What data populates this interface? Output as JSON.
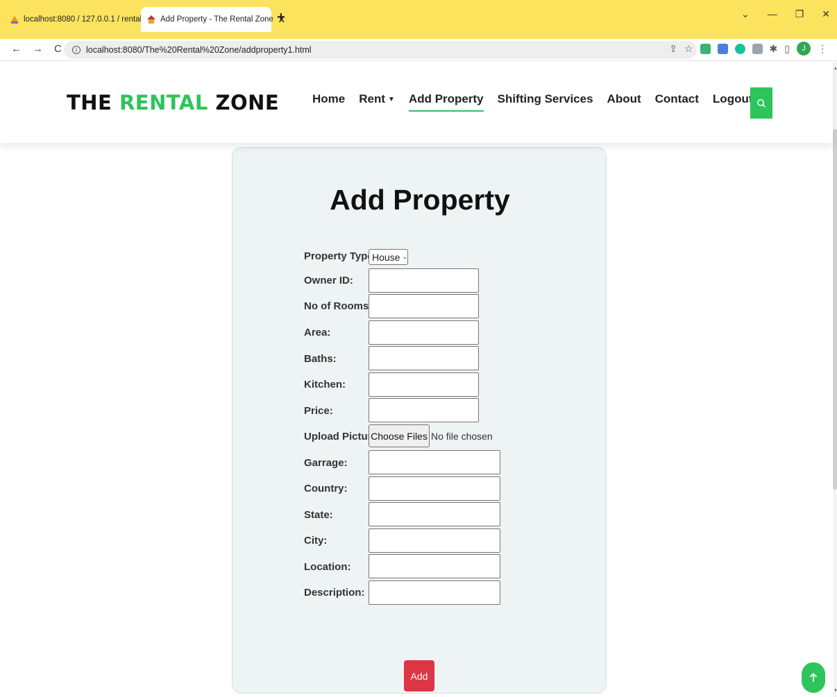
{
  "browser": {
    "tabs": [
      {
        "title": "localhost:8080 / 127.0.0.1 / rental"
      },
      {
        "title": "Add Property - The Rental Zone"
      }
    ],
    "tab_close": "X",
    "new_tab": "+",
    "url": "localhost:8080/The%20Rental%20Zone/addproperty1.html",
    "profile_initial": "J"
  },
  "header": {
    "logo_part1": "THE ",
    "logo_part2": "RENTAL",
    "logo_part3": " ZONE",
    "nav": [
      "Home",
      "Rent",
      "Add Property",
      "Shifting Services",
      "About",
      "Contact",
      "Logout"
    ],
    "active_nav": "Add Property",
    "accent_color": "#2ec45c"
  },
  "form": {
    "title": "Add Property",
    "property_type_label": "Property Type:",
    "property_type_value": "House",
    "fields": {
      "owner_id": "Owner ID:",
      "rooms": "No of Rooms:",
      "area": "Area:",
      "baths": "Baths:",
      "kitchen": "Kitchen:",
      "price": "Price:",
      "upload": "Upload Picture:",
      "garrage": "Garrage:",
      "country": "Country:",
      "state": "State:",
      "city": "City:",
      "location": "Location:",
      "description": "Description:"
    },
    "file_button": "Choose Files",
    "file_status": "No file chosen",
    "submit": "Add",
    "submit_color": "#dc3545"
  }
}
